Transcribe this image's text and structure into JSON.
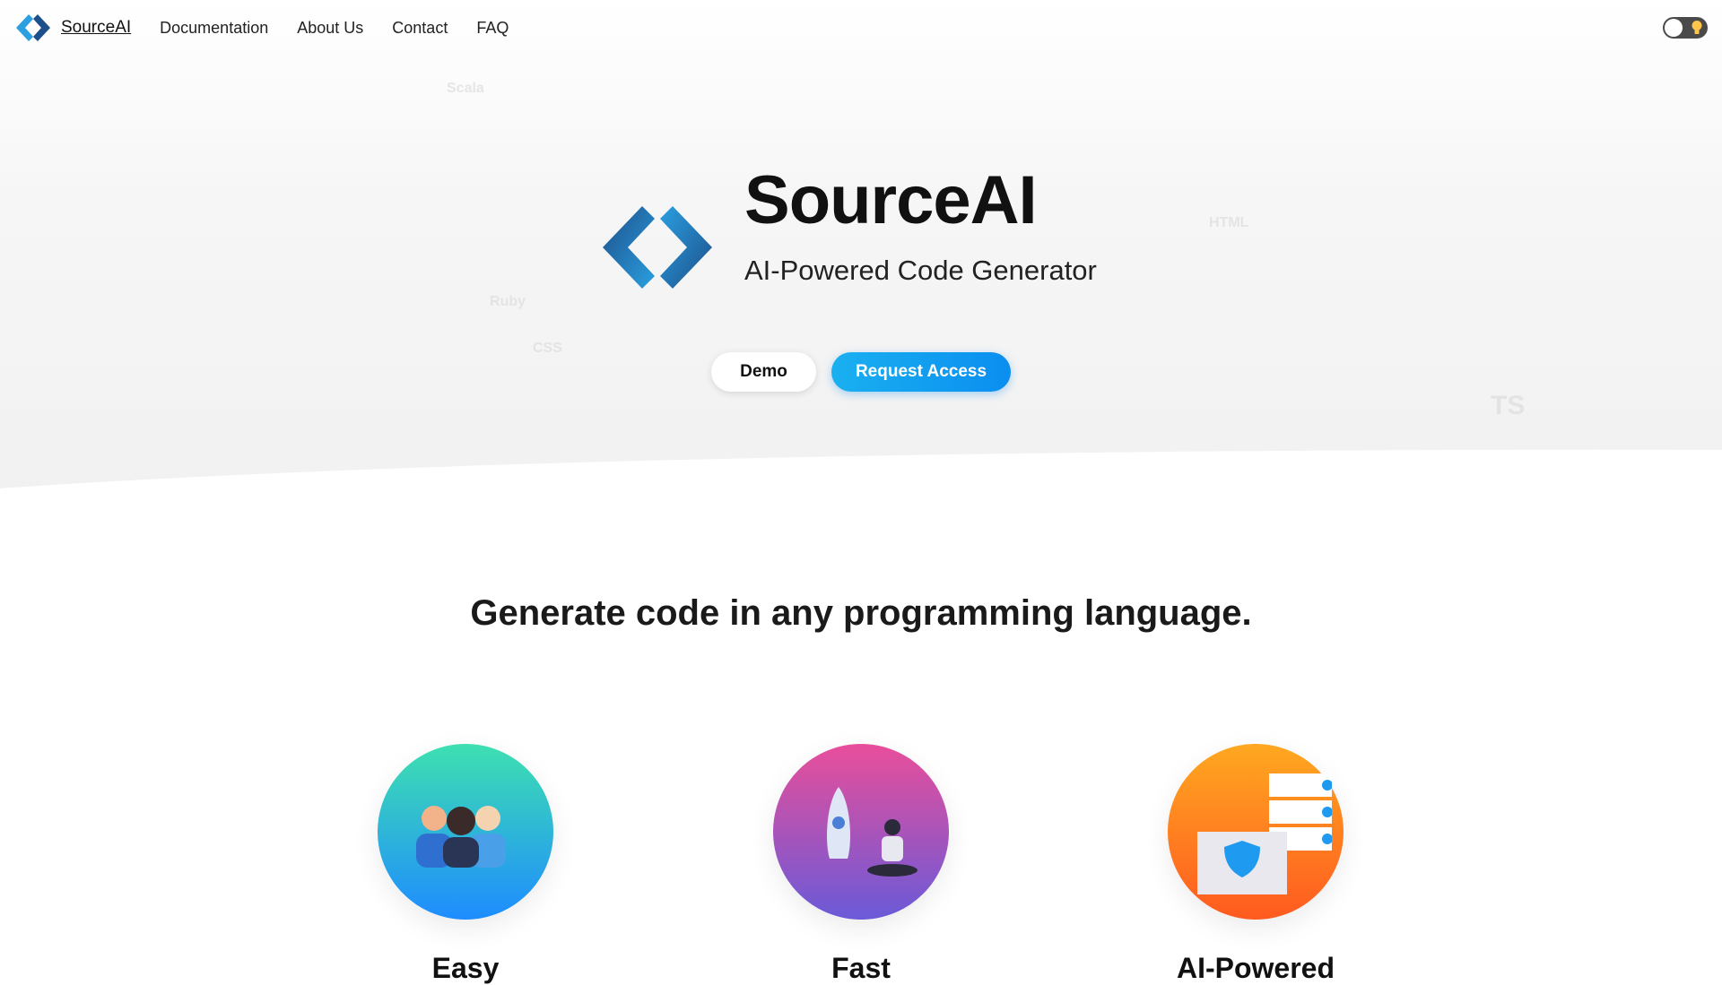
{
  "nav": {
    "brand": "SourceAI",
    "links": [
      "Documentation",
      "About Us",
      "Contact",
      "FAQ"
    ]
  },
  "theme_toggle": {
    "icon": "lightbulb-icon",
    "state": "light"
  },
  "hero": {
    "title": "SourceAI",
    "subtitle": "AI-Powered Code Generator",
    "demo_label": "Demo",
    "request_label": "Request Access"
  },
  "background_icons": [
    "Scala",
    "Ruby",
    "CSS",
    "HTML",
    "TS"
  ],
  "section": {
    "heading": "Generate code in any programming language."
  },
  "features": [
    {
      "label": "Easy",
      "color": "#1e90ff"
    },
    {
      "label": "Fast",
      "color": "#7a5bd0"
    },
    {
      "label": "AI-Powered",
      "color": "#ff6a1e"
    }
  ],
  "colors": {
    "accent": "#0a9cf0",
    "logo_light": "#2b9fe0",
    "logo_dark": "#1d4f8a"
  }
}
